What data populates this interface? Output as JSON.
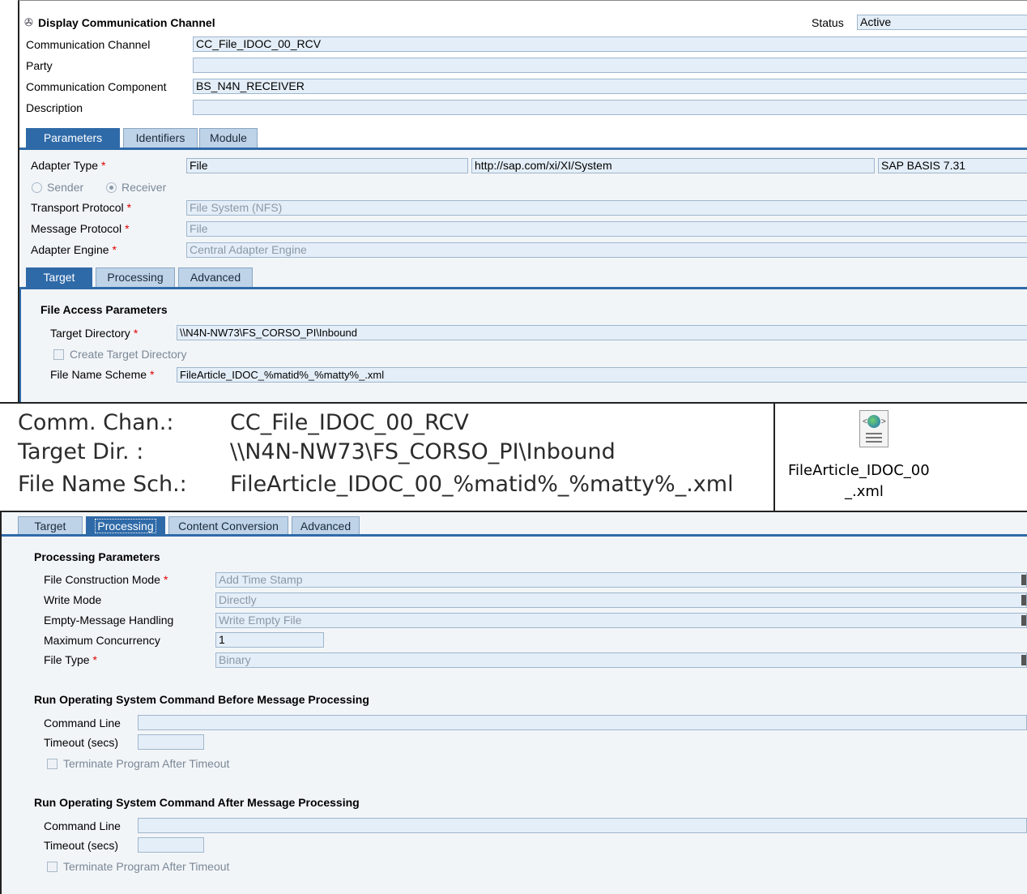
{
  "top": {
    "title": "Display Communication Channel",
    "status_label": "Status",
    "status_value": "Active",
    "fields": [
      {
        "label": "Communication Channel",
        "value": "CC_File_IDOC_00_RCV"
      },
      {
        "label": "Party",
        "value": ""
      },
      {
        "label": "Communication Component",
        "value": "BS_N4N_RECEIVER"
      },
      {
        "label": "Description",
        "value": ""
      }
    ],
    "tabs": [
      "Parameters",
      "Identifiers",
      "Module"
    ],
    "adapter_type_label": "Adapter Type",
    "adapter_type": "File",
    "adapter_namespace": "http://sap.com/xi/XI/System",
    "adapter_swc": "SAP BASIS 7.31",
    "sender_label": "Sender",
    "receiver_label": "Receiver",
    "transport_protocol_label": "Transport Protocol",
    "transport_protocol": "File System (NFS)",
    "message_protocol_label": "Message Protocol",
    "message_protocol": "File",
    "adapter_engine_label": "Adapter Engine",
    "adapter_engine": "Central Adapter Engine",
    "subtabs": [
      "Target",
      "Processing",
      "Advanced"
    ],
    "file_access_title": "File Access Parameters",
    "target_dir_label": "Target Directory",
    "target_dir": "\\\\N4N-NW73\\FS_CORSO_PI\\Inbound",
    "create_target_dir_label": "Create Target Directory",
    "file_name_scheme_label": "File Name Scheme",
    "file_name_scheme": "FileArticle_IDOC_%matid%_%matty%_.xml"
  },
  "summary": {
    "rows": [
      {
        "label": "Comm. Chan.:",
        "value": "CC_File_IDOC_00_RCV"
      },
      {
        "label": "Target Dir. :",
        "value": "\\\\N4N-NW73\\FS_CORSO_PI\\Inbound"
      },
      {
        "label": "File Name Sch.:",
        "value": "FileArticle_IDOC_00_%matid%_%matty%_.xml"
      }
    ],
    "file_name_line1": "FileArticle_IDOC_00",
    "file_name_line2": "_.xml"
  },
  "bottom": {
    "tabs": [
      "Target",
      "Processing",
      "Content Conversion",
      "Advanced"
    ],
    "processing_title": "Processing Parameters",
    "fields": [
      {
        "label": "File Construction Mode",
        "value": "Add Time Stamp"
      },
      {
        "label": "Write Mode",
        "value": "Directly"
      },
      {
        "label": "Empty-Message Handling",
        "value": "Write Empty File"
      },
      {
        "label": "Maximum Concurrency",
        "value": "1"
      },
      {
        "label": "File Type",
        "value": "Binary"
      }
    ],
    "before_title": "Run Operating System Command Before Message Processing",
    "after_title": "Run Operating System Command After Message Processing",
    "command_line_label": "Command Line",
    "timeout_label": "Timeout (secs)",
    "terminate_label": "Terminate Program After Timeout"
  }
}
